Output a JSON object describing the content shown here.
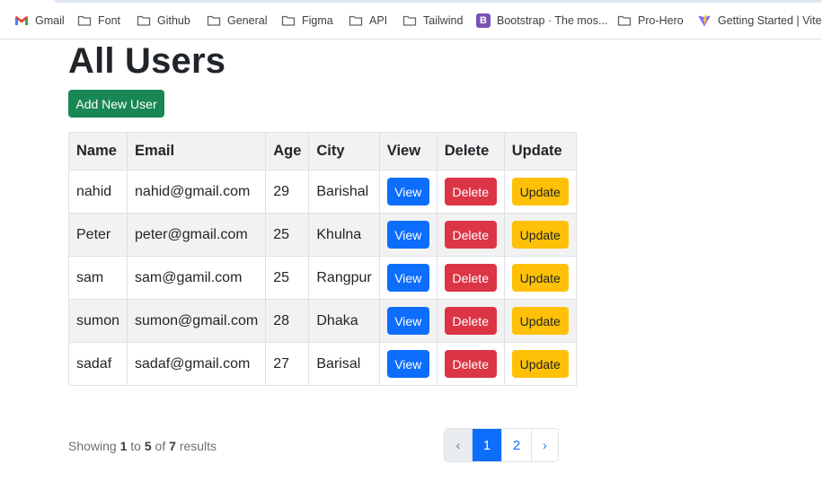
{
  "bookmarks": [
    {
      "label": "Gmail",
      "icon": "gmail-icon"
    },
    {
      "label": "Font",
      "icon": "folder-icon"
    },
    {
      "label": "Github",
      "icon": "folder-icon"
    },
    {
      "label": "General",
      "icon": "folder-icon"
    },
    {
      "label": "Figma",
      "icon": "folder-icon"
    },
    {
      "label": "API",
      "icon": "folder-icon"
    },
    {
      "label": "Tailwind",
      "icon": "folder-icon"
    },
    {
      "label": "Bootstrap · The mos...",
      "icon": "bootstrap-icon",
      "icon_text": "B"
    },
    {
      "label": "Pro-Hero",
      "icon": "folder-icon"
    },
    {
      "label": "Getting Started | Vite",
      "icon": "vite-icon"
    }
  ],
  "page": {
    "title": "All Users",
    "add_button": "Add New User"
  },
  "table": {
    "headers": [
      "Name",
      "Email",
      "Age",
      "City",
      "View",
      "Delete",
      "Update"
    ],
    "rows": [
      {
        "name": "nahid",
        "email": "nahid@gmail.com",
        "age": "29",
        "city": "Barishal",
        "view": "View",
        "delete": "Delete",
        "update": "Update"
      },
      {
        "name": "Peter",
        "email": "peter@gmail.com",
        "age": "25",
        "city": "Khulna",
        "view": "View",
        "delete": "Delete",
        "update": "Update"
      },
      {
        "name": "sam",
        "email": "sam@gamil.com",
        "age": "25",
        "city": "Rangpur",
        "view": "View",
        "delete": "Delete",
        "update": "Update"
      },
      {
        "name": "sumon",
        "email": "sumon@gmail.com",
        "age": "28",
        "city": "Dhaka",
        "view": "View",
        "delete": "Delete",
        "update": "Update"
      },
      {
        "name": "sadaf",
        "email": "sadaf@gmail.com",
        "age": "27",
        "city": "Barisal",
        "view": "View",
        "delete": "Delete",
        "update": "Update"
      }
    ]
  },
  "footer": {
    "showing_prefix": "Showing",
    "from": "1",
    "to_word": "to",
    "to": "5",
    "of_word": "of",
    "total": "7",
    "results_word": "results"
  },
  "pagination": {
    "prev": "‹",
    "pages": [
      "1",
      "2"
    ],
    "active_page": "1",
    "next": "›"
  },
  "colors": {
    "success": "#198754",
    "primary": "#0d6efd",
    "danger": "#dc3545",
    "warning": "#ffc107"
  }
}
